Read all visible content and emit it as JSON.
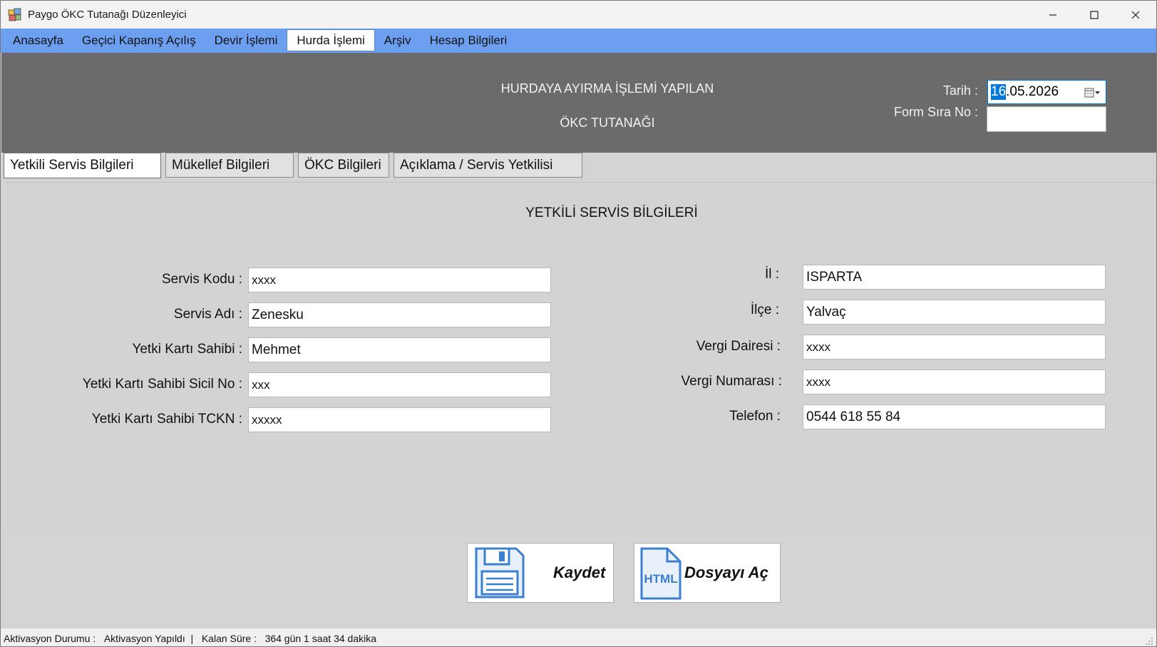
{
  "window": {
    "title": "Paygo ÖKC Tutanağı Düzenleyici",
    "minimize": "—",
    "maximize": "☐",
    "close": "✕"
  },
  "menu": {
    "items": [
      "Anasayfa",
      "Geçici Kapanış Açılış",
      "Devir İşlemi",
      "Hurda İşlemi",
      "Arşiv",
      "Hesap Bilgileri"
    ],
    "active": "Hurda İşlemi"
  },
  "header": {
    "title1": "HURDAYA AYIRMA İŞLEMİ YAPILAN",
    "title2": "ÖKC TUTANAĞI",
    "date_label": "Tarih :",
    "date_selected": "16",
    "date_rest": ".05.2026",
    "form_label": "Form Sıra No :",
    "form_value": ""
  },
  "tabs": [
    "Yetkili Servis Bilgileri",
    "Mükellef Bilgileri",
    "ÖKC Bilgileri",
    "Açıklama / Servis Yetkilisi"
  ],
  "section": {
    "title": "YETKİLİ SERVİS BİLGİLERİ",
    "left": [
      {
        "label": "Servis Kodu :",
        "value": "xxxx"
      },
      {
        "label": "Servis Adı :",
        "value": "Zenesku"
      },
      {
        "label": "Yetki Kartı Sahibi :",
        "value": "Mehmet"
      },
      {
        "label": "Yetki Kartı Sahibi Sicil No :",
        "value": "xxx"
      },
      {
        "label": "Yetki Kartı Sahibi TCKN :",
        "value": "xxxxx"
      }
    ],
    "right": [
      {
        "label": "İl :",
        "value": "ISPARTA"
      },
      {
        "label": "İlçe  :",
        "value": "Yalvaç"
      },
      {
        "label": "Vergi Dairesi :",
        "value": "xxxx"
      },
      {
        "label": "Vergi Numarası :",
        "value": "xxxx"
      },
      {
        "label": "Telefon :",
        "value": "0544 618 55 84"
      }
    ]
  },
  "actions": {
    "save": "Kaydet",
    "open": "Dosyayı Aç",
    "html_icon_text": "HTML"
  },
  "status": {
    "activation_label": "Aktivasyon Durumu :",
    "activation_value": "Aktivasyon Yapıldı",
    "separator": "|",
    "remaining_label": "Kalan Süre :",
    "remaining_value": "364 gün 1 saat 34 dakika"
  },
  "colors": {
    "menubar": "#6d9ff0",
    "header": "#6b6b6b",
    "selection": "#0078d7",
    "icon_blue": "#3b7fd0"
  },
  "icons": [
    "app-icon",
    "calendar-icon",
    "save-icon",
    "html-file-icon",
    "resize-grip-icon"
  ]
}
